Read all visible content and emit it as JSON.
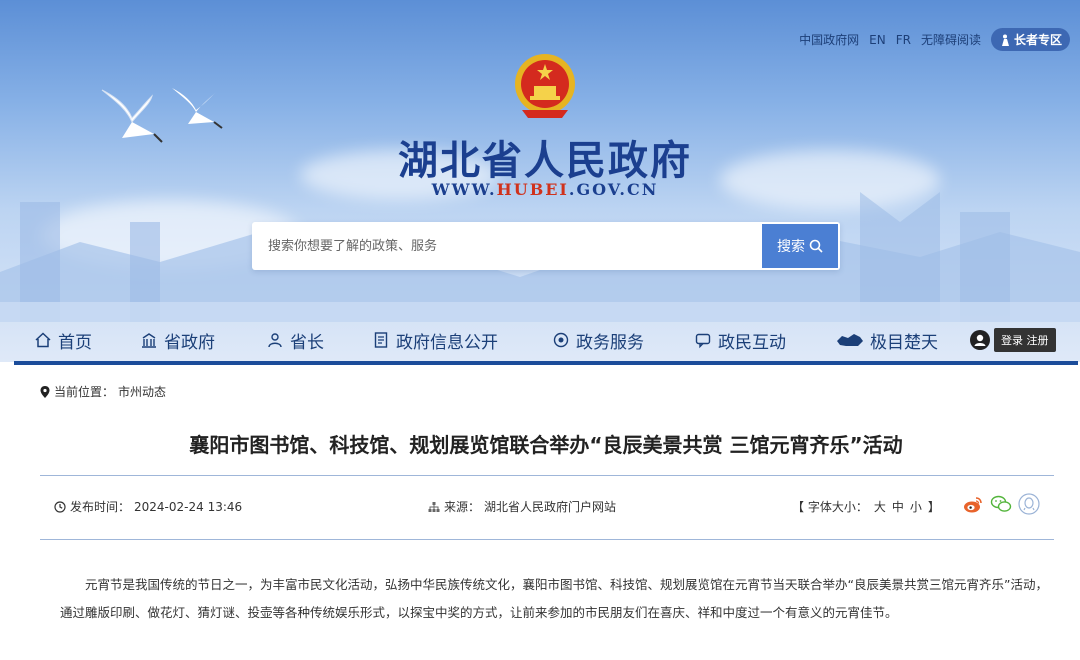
{
  "top_links": {
    "gov_portal": "中国政府网",
    "en": "EN",
    "fr": "FR",
    "accessible": "无障碍阅读",
    "elder": "长者专区"
  },
  "header": {
    "title": "湖北省人民政府",
    "url_prefix": "WWW.",
    "url_highlight": "HUBEI",
    "url_suffix": ".GOV.CN"
  },
  "search": {
    "placeholder": "搜索你想要了解的政策、服务",
    "button_label": "搜索"
  },
  "nav": {
    "items": [
      {
        "label": "首页",
        "icon": "home-icon"
      },
      {
        "label": "省政府",
        "icon": "building-icon"
      },
      {
        "label": "省长",
        "icon": "person-icon"
      },
      {
        "label": "政府信息公开",
        "icon": "document-icon"
      },
      {
        "label": "政务服务",
        "icon": "service-icon"
      },
      {
        "label": "政民互动",
        "icon": "chat-icon"
      },
      {
        "label": "极目楚天",
        "icon": "map-icon"
      }
    ],
    "login_label": "登录 注册"
  },
  "breadcrumb": {
    "prefix": "当前位置：",
    "current": "市州动态"
  },
  "article": {
    "title": "襄阳市图书馆、科技馆、规划展览馆联合举办“良辰美景共赏 三馆元宵齐乐”活动",
    "published_label": "发布时间：",
    "published": "2024-02-24 13:46",
    "source_label": "来源：",
    "source": "湖北省人民政府门户网站",
    "fontsize_open": "【 字体大小：",
    "fontsize_large": "大",
    "fontsize_medium": "中",
    "fontsize_small": "小",
    "fontsize_close": "】",
    "body": "元宵节是我国传统的节日之一，为丰富市民文化活动，弘扬中华民族传统文化，襄阳市图书馆、科技馆、规划展览馆在元宵节当天联合举办“良辰美景共赏三馆元宵齐乐”活动，通过雕版印刷、做花灯、猜灯谜、投壶等各种传统娱乐形式，以探宝中奖的方式，让前来参加的市民朋友们在喜庆、祥和中度过一个有意义的元宵佳节。"
  },
  "colors": {
    "brand_blue": "#1b4c9a",
    "title_blue": "#1b3f8f",
    "url_red": "#d0321c",
    "search_button": "#4b7fd3",
    "weibo_orange": "#e8632b",
    "wechat_green": "#52b43a"
  }
}
